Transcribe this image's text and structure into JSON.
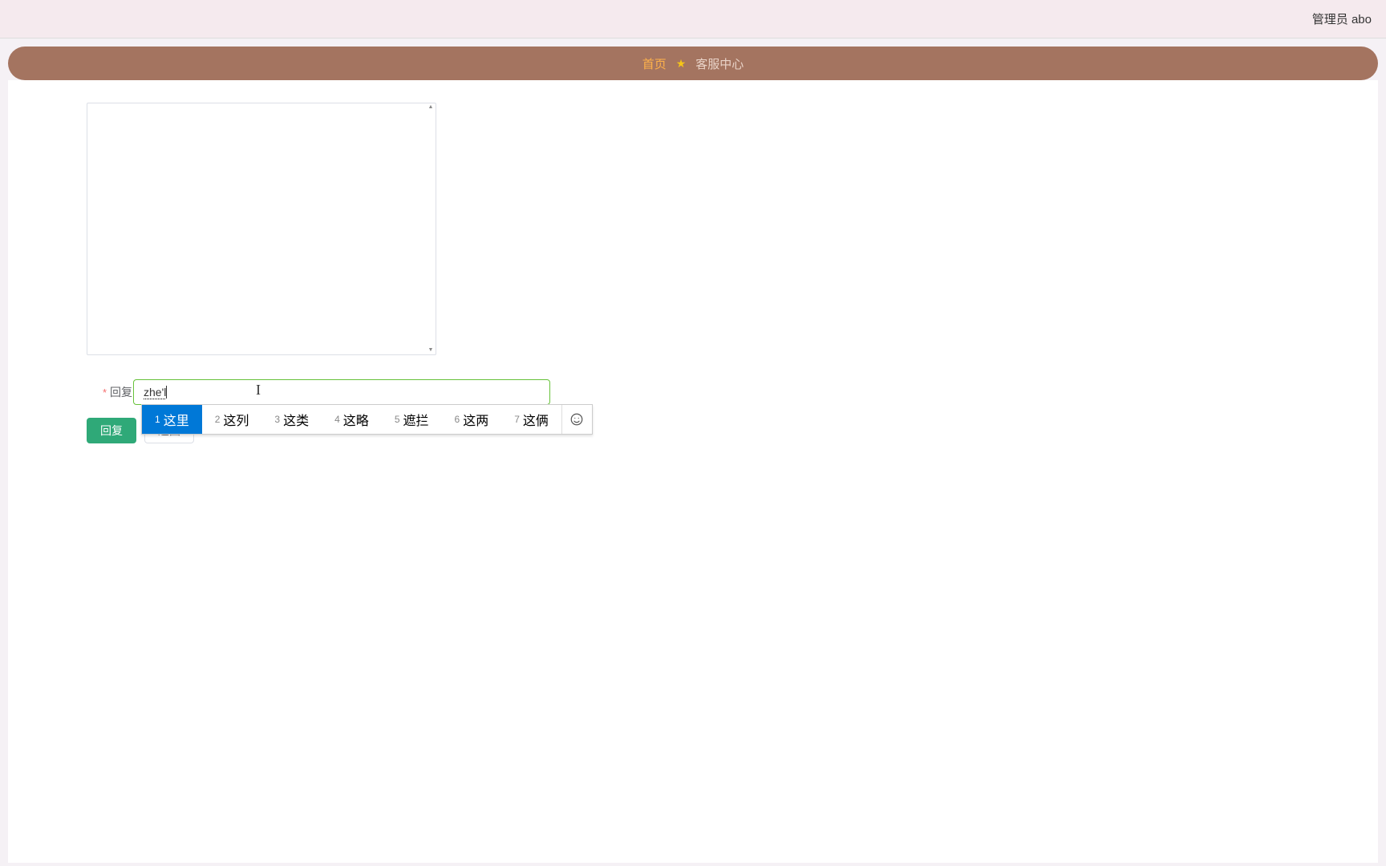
{
  "header": {
    "user_label": "管理员 abo"
  },
  "nav": {
    "home": "首页",
    "service": "客服中心"
  },
  "reply": {
    "label": "回复",
    "input_value": "zhe'l"
  },
  "buttons": {
    "reply": "回复",
    "back": "返回"
  },
  "ime": {
    "candidates": [
      {
        "index": "1",
        "text": "这里"
      },
      {
        "index": "2",
        "text": "这列"
      },
      {
        "index": "3",
        "text": "这类"
      },
      {
        "index": "4",
        "text": "这略"
      },
      {
        "index": "5",
        "text": "遮拦"
      },
      {
        "index": "6",
        "text": "这两"
      },
      {
        "index": "7",
        "text": "这俩"
      }
    ],
    "selected_index": 0
  }
}
